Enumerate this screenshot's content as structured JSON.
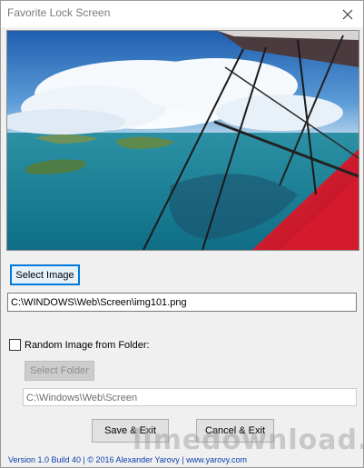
{
  "window": {
    "title": "Favorite Lock Screen"
  },
  "icons": {
    "close": "close-icon"
  },
  "buttons": {
    "select_image": "Select Image",
    "select_folder": "Select Folder",
    "save_exit": "Save & Exit",
    "cancel_exit": "Cancel & Exit"
  },
  "image_path": {
    "value": "C:\\WINDOWS\\Web\\Screen\\img101.png"
  },
  "random_folder": {
    "label": "Random Image from Folder:",
    "checked": false
  },
  "folder_path": {
    "value": "C:\\Windows\\Web\\Screen"
  },
  "footer": {
    "text": "Version 1.0 Build 40 | © 2016 Alexander Yarovy | www.yarovy.com"
  },
  "watermark": {
    "text": "limedownload.com"
  },
  "colors": {
    "focus_border": "#0078d7",
    "footer_text": "#0b3fae"
  }
}
